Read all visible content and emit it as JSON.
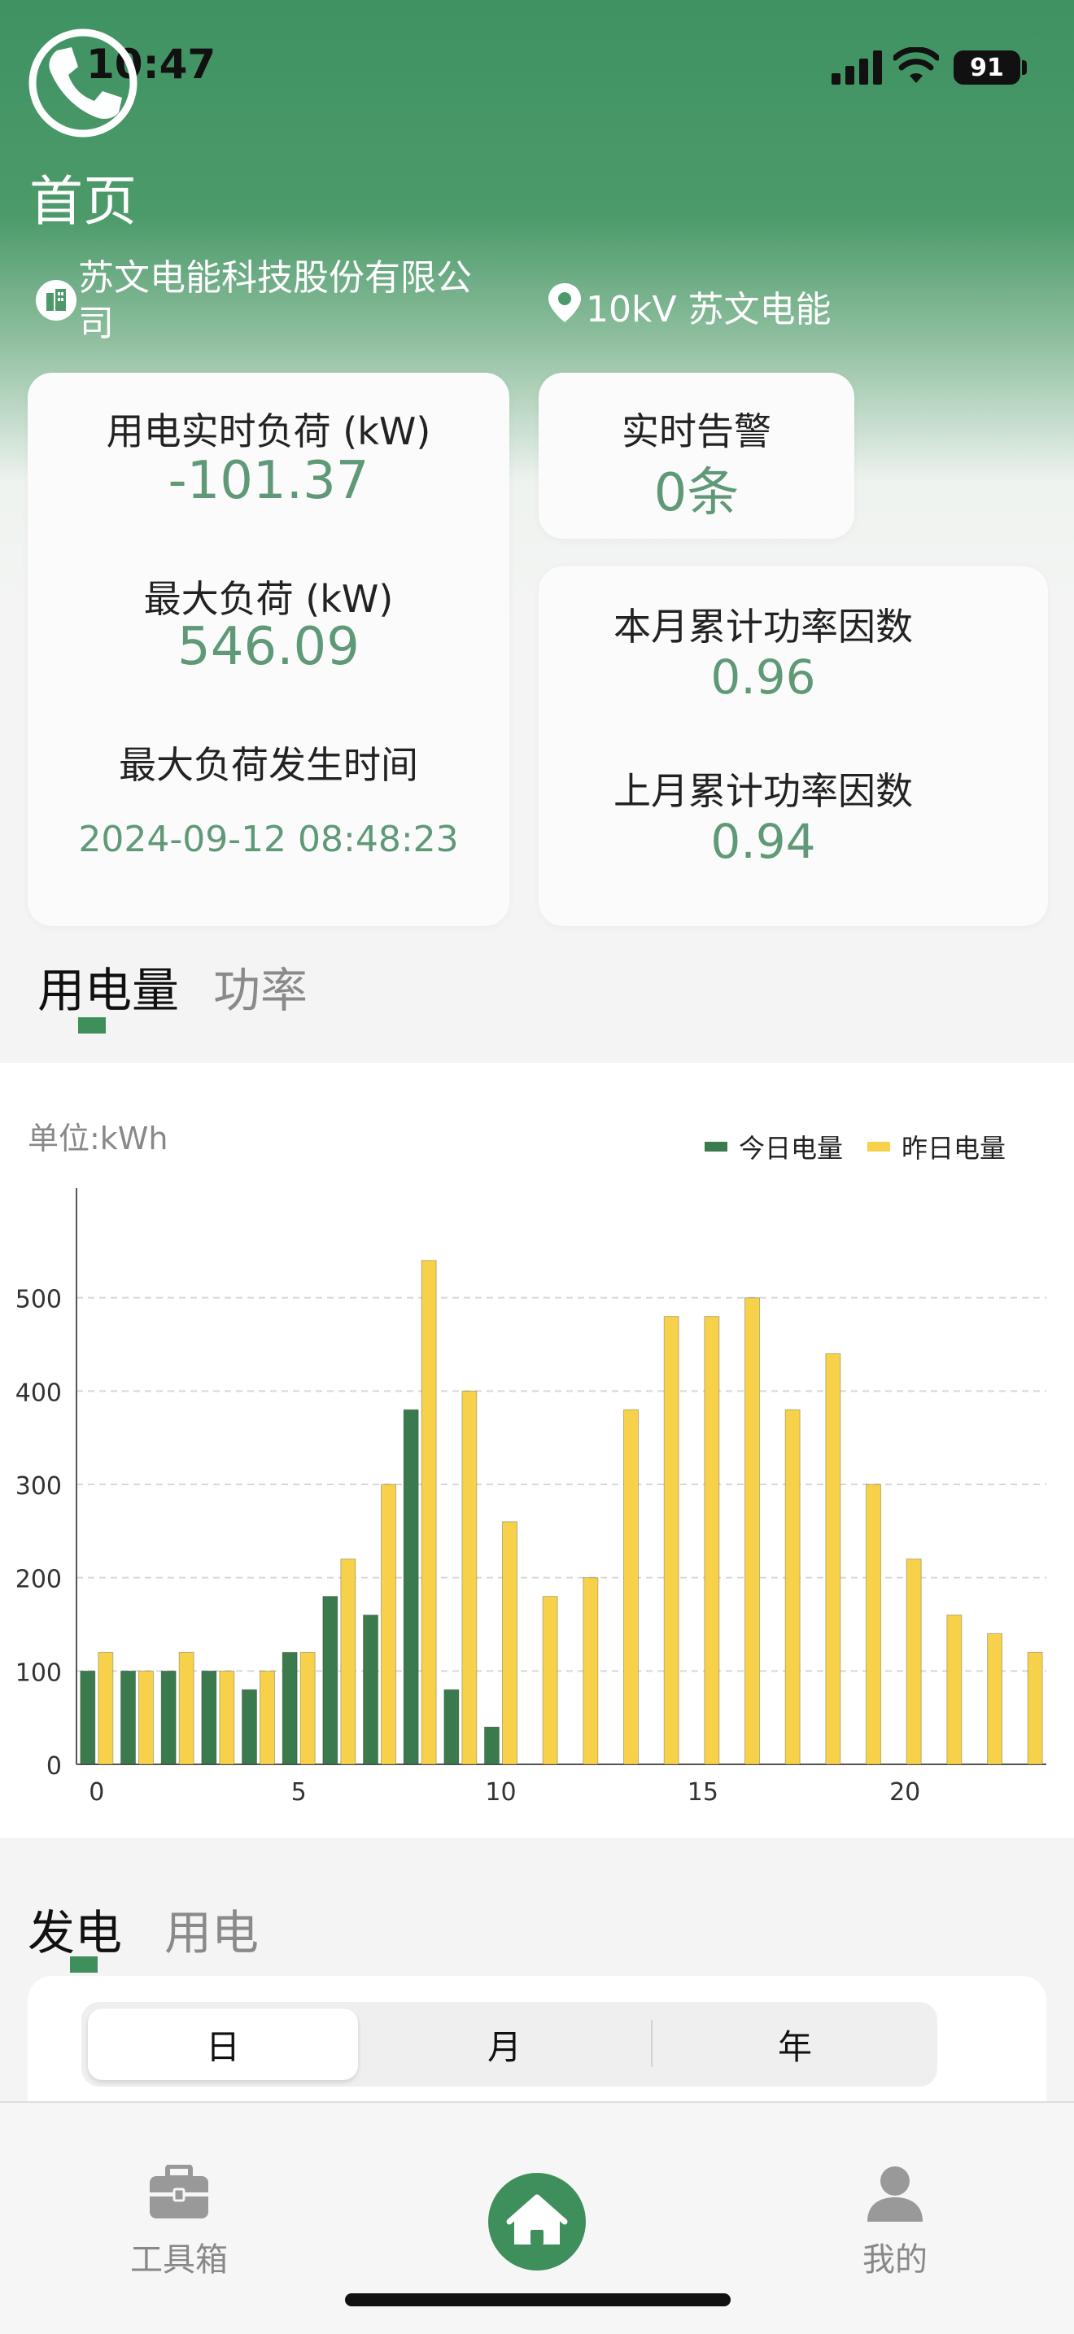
{
  "status_bar": {
    "time": "10:47",
    "battery": "91"
  },
  "header": {
    "title": "首页",
    "company": "苏文电能科技股份有限公司",
    "location": "10kV 苏文电能"
  },
  "load_card": {
    "realtime_label": "用电实时负荷 (kW)",
    "realtime_value": "-101.37",
    "max_label": "最大负荷 (kW)",
    "max_value": "546.09",
    "max_time_label": "最大负荷发生时间",
    "max_time_value": "2024-09-12 08:48:23"
  },
  "alarm_card": {
    "label": "实时告警",
    "value": "0条"
  },
  "factor_card": {
    "this_month_label": "本月累计功率因数",
    "this_month_value": "0.96",
    "last_month_label": "上月累计功率因数",
    "last_month_value": "0.94"
  },
  "energy_tabs": {
    "active": "用电量",
    "inactive": "功率"
  },
  "chart_unit": "单位:kWh",
  "chart_data": {
    "type": "bar",
    "x": [
      0,
      1,
      2,
      3,
      4,
      5,
      6,
      7,
      8,
      9,
      10,
      11,
      12,
      13,
      14,
      15,
      16,
      17,
      18,
      19,
      20,
      21,
      22,
      23
    ],
    "series": [
      {
        "name": "今日电量",
        "color": "#3a7a4c",
        "values": [
          100,
          100,
          100,
          100,
          80,
          120,
          180,
          160,
          380,
          80,
          40,
          0,
          0,
          0,
          0,
          0,
          0,
          0,
          0,
          0,
          0,
          0,
          0,
          0
        ]
      },
      {
        "name": "昨日电量",
        "color": "#f7d14a",
        "values": [
          120,
          100,
          120,
          100,
          100,
          120,
          220,
          300,
          540,
          400,
          260,
          180,
          200,
          380,
          480,
          480,
          500,
          380,
          440,
          300,
          220,
          160,
          140,
          120
        ]
      }
    ],
    "x_ticks": [
      0,
      5,
      10,
      15,
      20
    ],
    "y_ticks": [
      0,
      100,
      200,
      300,
      400,
      500
    ],
    "ylim": [
      0,
      600
    ],
    "grid": "horizontal dashed",
    "legend": "top-right"
  },
  "gen_tabs": {
    "active": "发电",
    "inactive": "用电"
  },
  "period_segments": [
    "日",
    "月",
    "年"
  ],
  "bottom_nav": {
    "toolbox": "工具箱",
    "mine": "我的"
  }
}
